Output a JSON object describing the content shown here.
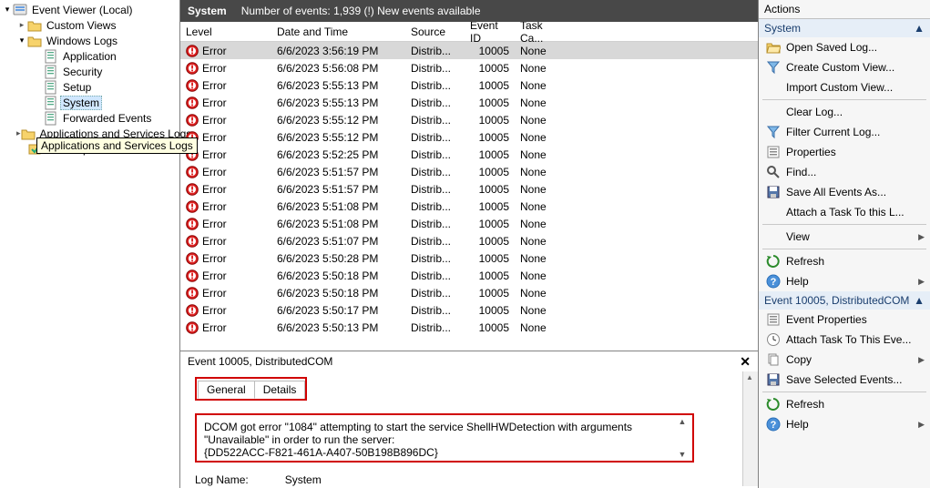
{
  "tree": {
    "root": "Event Viewer (Local)",
    "customViews": "Custom Views",
    "windowsLogs": "Windows Logs",
    "application": "Application",
    "security": "Security",
    "setup": "Setup",
    "system": "System",
    "forwarded": "Forwarded Events",
    "apps": "Applications and Services Logs",
    "subs": "Subscriptions",
    "tooltip": "Applications and Services Logs"
  },
  "header": {
    "title": "System",
    "count": "Number of events: 1,939 (!) New events available"
  },
  "columns": {
    "level": "Level",
    "date": "Date and Time",
    "source": "Source",
    "eid": "Event ID",
    "task": "Task Ca..."
  },
  "rows": [
    {
      "level": "Error",
      "date": "6/6/2023 3:56:19 PM",
      "src": "Distrib...",
      "eid": "10005",
      "task": "None",
      "sel": true
    },
    {
      "level": "Error",
      "date": "6/6/2023 5:56:08 PM",
      "src": "Distrib...",
      "eid": "10005",
      "task": "None"
    },
    {
      "level": "Error",
      "date": "6/6/2023 5:55:13 PM",
      "src": "Distrib...",
      "eid": "10005",
      "task": "None"
    },
    {
      "level": "Error",
      "date": "6/6/2023 5:55:13 PM",
      "src": "Distrib...",
      "eid": "10005",
      "task": "None"
    },
    {
      "level": "Error",
      "date": "6/6/2023 5:55:12 PM",
      "src": "Distrib...",
      "eid": "10005",
      "task": "None"
    },
    {
      "level": "Error",
      "date": "6/6/2023 5:55:12 PM",
      "src": "Distrib...",
      "eid": "10005",
      "task": "None"
    },
    {
      "level": "Error",
      "date": "6/6/2023 5:52:25 PM",
      "src": "Distrib...",
      "eid": "10005",
      "task": "None"
    },
    {
      "level": "Error",
      "date": "6/6/2023 5:51:57 PM",
      "src": "Distrib...",
      "eid": "10005",
      "task": "None"
    },
    {
      "level": "Error",
      "date": "6/6/2023 5:51:57 PM",
      "src": "Distrib...",
      "eid": "10005",
      "task": "None"
    },
    {
      "level": "Error",
      "date": "6/6/2023 5:51:08 PM",
      "src": "Distrib...",
      "eid": "10005",
      "task": "None"
    },
    {
      "level": "Error",
      "date": "6/6/2023 5:51:08 PM",
      "src": "Distrib...",
      "eid": "10005",
      "task": "None"
    },
    {
      "level": "Error",
      "date": "6/6/2023 5:51:07 PM",
      "src": "Distrib...",
      "eid": "10005",
      "task": "None"
    },
    {
      "level": "Error",
      "date": "6/6/2023 5:50:28 PM",
      "src": "Distrib...",
      "eid": "10005",
      "task": "None"
    },
    {
      "level": "Error",
      "date": "6/6/2023 5:50:18 PM",
      "src": "Distrib...",
      "eid": "10005",
      "task": "None"
    },
    {
      "level": "Error",
      "date": "6/6/2023 5:50:18 PM",
      "src": "Distrib...",
      "eid": "10005",
      "task": "None"
    },
    {
      "level": "Error",
      "date": "6/6/2023 5:50:17 PM",
      "src": "Distrib...",
      "eid": "10005",
      "task": "None"
    },
    {
      "level": "Error",
      "date": "6/6/2023 5:50:13 PM",
      "src": "Distrib...",
      "eid": "10005",
      "task": "None"
    }
  ],
  "detail": {
    "title": "Event 10005, DistributedCOM",
    "tabGeneral": "General",
    "tabDetails": "Details",
    "msg1": "DCOM got error \"1084\" attempting to start the service ShellHWDetection with arguments",
    "msg2": "\"Unavailable\" in order to run the server:",
    "msg3": "{DD522ACC-F821-461A-A407-50B198B896DC}",
    "logNameLabel": "Log Name:",
    "logNameValue": "System"
  },
  "actions": {
    "header": "Actions",
    "section1": "System",
    "openSaved": "Open Saved Log...",
    "createCustom": "Create Custom View...",
    "importCustom": "Import Custom View...",
    "clearLog": "Clear Log...",
    "filterCurrent": "Filter Current Log...",
    "properties": "Properties",
    "find": "Find...",
    "saveAll": "Save All Events As...",
    "attachTask": "Attach a Task To this L...",
    "view": "View",
    "refresh": "Refresh",
    "help": "Help",
    "section2": "Event 10005, DistributedCOM",
    "eventProps": "Event Properties",
    "attachTaskEv": "Attach Task To This Eve...",
    "copy": "Copy",
    "saveSelected": "Save Selected Events...",
    "refresh2": "Refresh",
    "help2": "Help"
  }
}
